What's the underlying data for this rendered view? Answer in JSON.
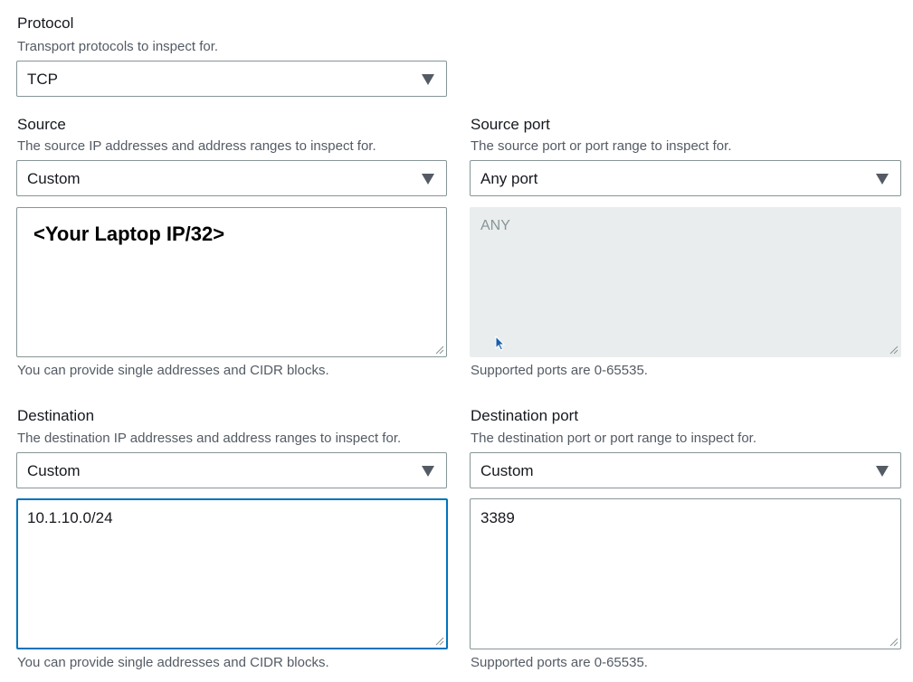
{
  "protocol": {
    "label": "Protocol",
    "description": "Transport protocols to inspect for.",
    "selected": "TCP"
  },
  "source": {
    "label": "Source",
    "description": "The source IP addresses and address ranges to inspect for.",
    "selected": "Custom",
    "value": "<Your Laptop IP/32>",
    "hint": "You can provide single addresses and CIDR blocks."
  },
  "source_port": {
    "label": "Source port",
    "description": "The source port or port range to inspect for.",
    "selected": "Any port",
    "value": "ANY",
    "hint": "Supported ports are 0-65535."
  },
  "destination": {
    "label": "Destination",
    "description": "The destination IP addresses and address ranges to inspect for.",
    "selected": "Custom",
    "value": "10.1.10.0/24",
    "hint": "You can provide single addresses and CIDR blocks."
  },
  "destination_port": {
    "label": "Destination port",
    "description": "The destination port or port range to inspect for.",
    "selected": "Custom",
    "value": "3389",
    "hint": "Supported ports are 0-65535."
  },
  "colors": {
    "focus_border": "#0073bb",
    "border": "#879596",
    "disabled_bg": "#eaeded",
    "description_text": "#545b64"
  }
}
